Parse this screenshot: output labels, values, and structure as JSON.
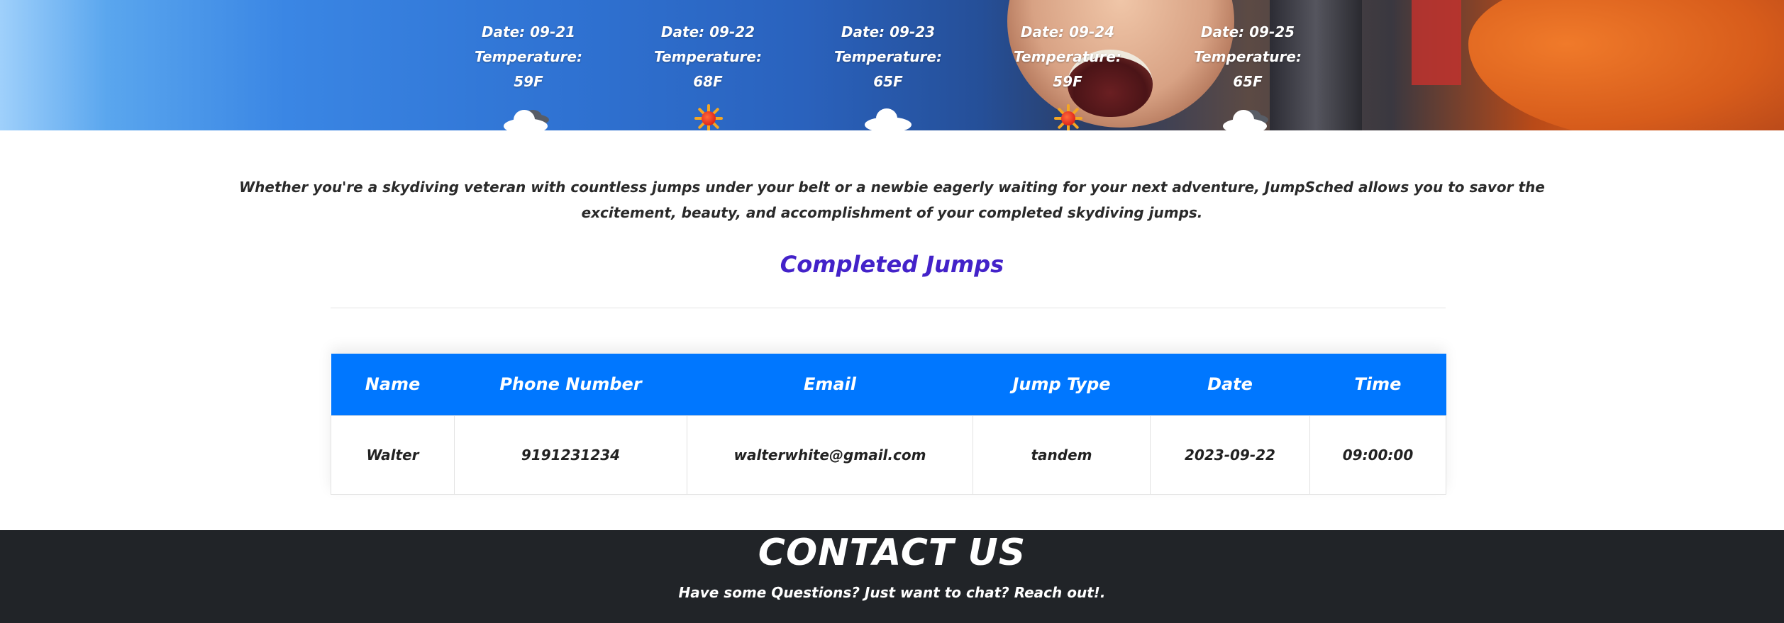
{
  "hero": {
    "forecast": [
      {
        "date": "Date: 09-21",
        "temperature": "Temperature: 59F",
        "icon": "partly-cloudy-dark-icon"
      },
      {
        "date": "Date: 09-22",
        "temperature": "Temperature: 68F",
        "icon": "sun-icon"
      },
      {
        "date": "Date: 09-23",
        "temperature": "Temperature: 65F",
        "icon": "cloud-icon"
      },
      {
        "date": "Date: 09-24",
        "temperature": "Temperature: 59F",
        "icon": "sun-icon"
      },
      {
        "date": "Date: 09-25",
        "temperature": "Temperature: 65F",
        "icon": "partly-cloudy-dark-icon"
      }
    ]
  },
  "intro": {
    "line1": "Whether you're a skydiving veteran with countless jumps under your belt or a newbie eagerly waiting for your next adventure, JumpSched allows you to savor the",
    "line2": "excitement, beauty, and accomplishment of your completed skydiving jumps."
  },
  "section_title": "Completed Jumps",
  "table": {
    "headers": [
      "Name",
      "Phone Number",
      "Email",
      "Jump Type",
      "Date",
      "Time"
    ],
    "rows": [
      [
        "Walter",
        "9191231234",
        "walterwhite@gmail.com",
        "tandem",
        "2023-09-22",
        "09:00:00"
      ]
    ]
  },
  "footer": {
    "title": "CONTACT US",
    "subtitle": "Have some Questions? Just want to chat? Reach out!."
  },
  "colors": {
    "header_blue": "#0077ff",
    "title_purple": "#4322c9",
    "footer_dark": "#212428"
  }
}
